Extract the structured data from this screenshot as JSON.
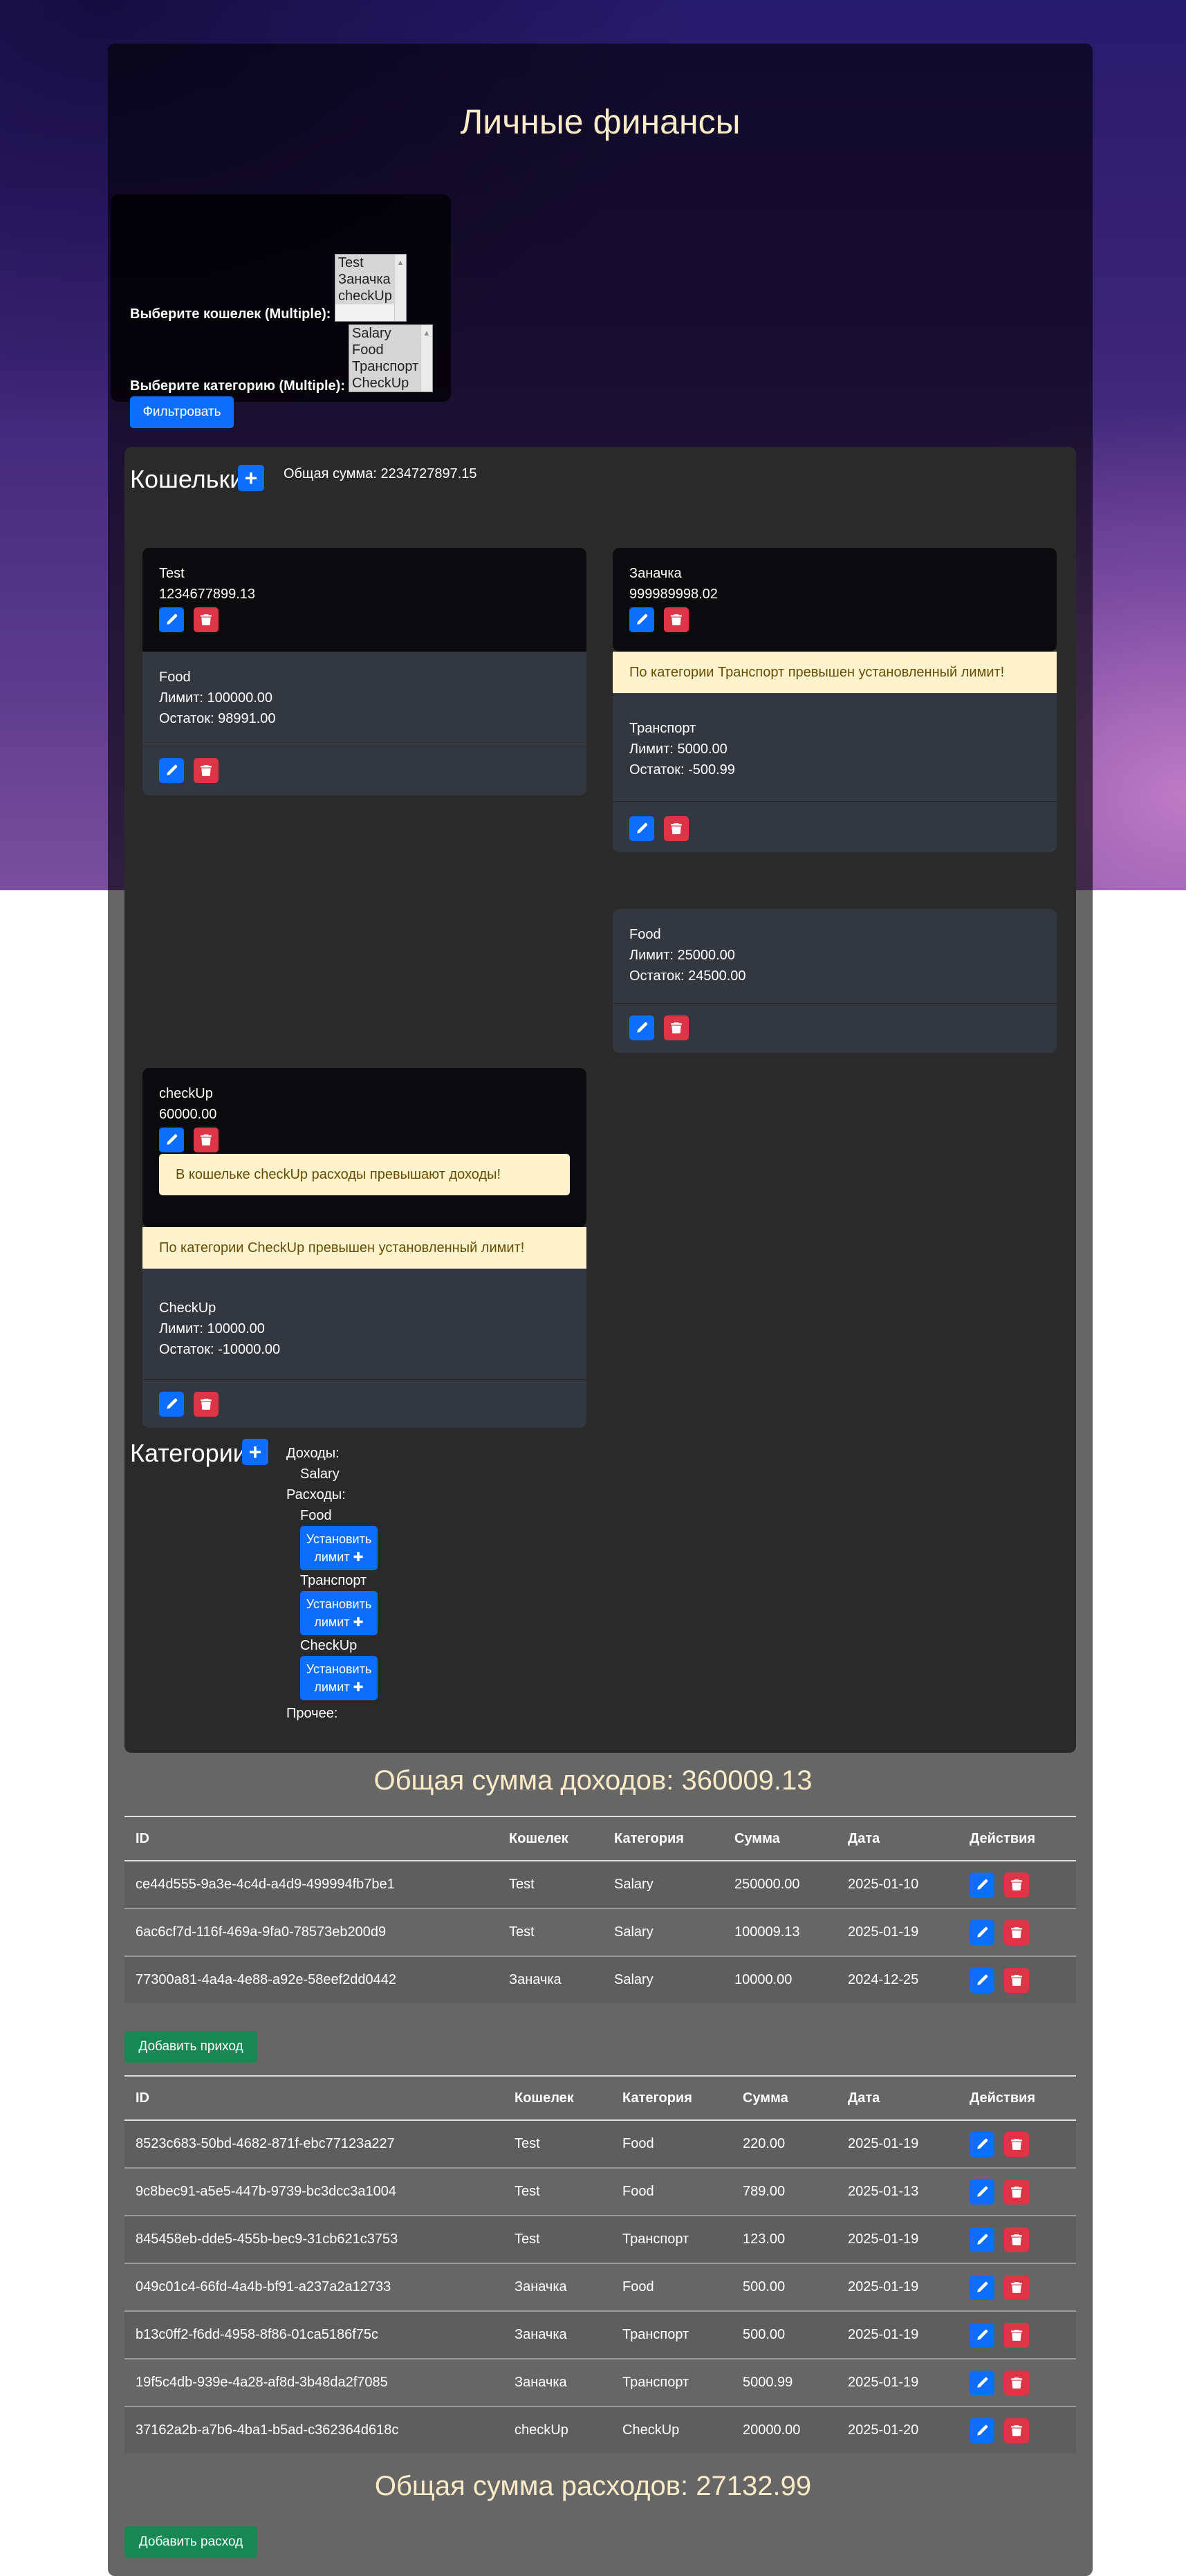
{
  "title": "Личные финансы",
  "filter": {
    "wallet_label": "Выберите кошелек (Multiple):",
    "wallet_options": [
      "Test",
      "Заначка",
      "checkUp"
    ],
    "category_label": "Выберите категорию (Multiple):",
    "category_options": [
      "Salary",
      "Food",
      "Транспорт",
      "CheckUp"
    ],
    "button": "Фильтровать"
  },
  "wallets": {
    "heading": "Кошельки",
    "add_symbol": "+",
    "total": "Общая сумма: 2234727897.15",
    "items": [
      {
        "name": "Test",
        "amount": "1234677899.13",
        "categories": [
          {
            "name": "Food",
            "limit": "Лимит: 100000.00",
            "rest": "Остаток: 98991.00"
          }
        ]
      },
      {
        "name": "Заначка",
        "amount": "999989998.02",
        "alert": "По категории Транспорт превышен установленный лимит!",
        "categories": [
          {
            "name": "Транспорт",
            "limit": "Лимит: 5000.00",
            "rest": "Остаток: -500.99"
          },
          {
            "name": "Food",
            "limit": "Лимит: 25000.00",
            "rest": "Остаток: 24500.00"
          }
        ]
      },
      {
        "name": "checkUp",
        "amount": "60000.00",
        "inner_alert": "В кошельке checkUp расходы превышают доходы!",
        "alert": "По категории CheckUp превышен установленный лимит!",
        "categories": [
          {
            "name": "CheckUp",
            "limit": "Лимит: 10000.00",
            "rest": "Остаток: -10000.00"
          }
        ]
      }
    ]
  },
  "categories": {
    "heading": "Категории",
    "add_symbol": "+",
    "income_label": "Доходы:",
    "income": [
      "Salary"
    ],
    "expense_label": "Расходы:",
    "expense": [
      "Food",
      "Транспорт",
      "CheckUp"
    ],
    "limit_button_line1": "Установить",
    "limit_button_line2": "лимит ✚",
    "other_label": "Прочее:"
  },
  "income_total": "Общая сумма доходов: 360009.13",
  "table_headers": [
    "ID",
    "Кошелек",
    "Категория",
    "Сумма",
    "Дата",
    "Действия"
  ],
  "income_rows": [
    [
      "ce44d555-9a3e-4c4d-a4d9-499994fb7be1",
      "Test",
      "Salary",
      "250000.00",
      "2025-01-10"
    ],
    [
      "6ac6cf7d-116f-469a-9fa0-78573eb200d9",
      "Test",
      "Salary",
      "100009.13",
      "2025-01-19"
    ],
    [
      "77300a81-4a4a-4e88-a92e-58eef2dd0442",
      "Заначка",
      "Salary",
      "10000.00",
      "2024-12-25"
    ]
  ],
  "add_income": "Добавить приход",
  "expense_rows": [
    [
      "8523c683-50bd-4682-871f-ebc77123a227",
      "Test",
      "Food",
      "220.00",
      "2025-01-19"
    ],
    [
      "9c8bec91-a5e5-447b-9739-bc3dcc3a1004",
      "Test",
      "Food",
      "789.00",
      "2025-01-13"
    ],
    [
      "845458eb-dde5-455b-bec9-31cb621c3753",
      "Test",
      "Транспорт",
      "123.00",
      "2025-01-19"
    ],
    [
      "049c01c4-66fd-4a4b-bf91-a237a2a12733",
      "Заначка",
      "Food",
      "500.00",
      "2025-01-19"
    ],
    [
      "b13c0ff2-f6dd-4958-8f86-01ca5186f75c",
      "Заначка",
      "Транспорт",
      "500.00",
      "2025-01-19"
    ],
    [
      "19f5c4db-939e-4a28-af8d-3b48da2f7085",
      "Заначка",
      "Транспорт",
      "5000.99",
      "2025-01-19"
    ],
    [
      "37162a2b-a7b6-4ba1-b5ad-c362364d618c",
      "checkUp",
      "CheckUp",
      "20000.00",
      "2025-01-20"
    ]
  ],
  "expense_total": "Общая сумма расходов: 27132.99",
  "add_expense": "Добавить расход",
  "icons": {
    "edit": "pencil-icon",
    "delete": "trash-icon"
  },
  "colors": {
    "primary": "#0d6efd",
    "danger": "#dc3545",
    "success": "#198754",
    "warning_bg": "#fff3cd",
    "title": "#fdebc8"
  }
}
